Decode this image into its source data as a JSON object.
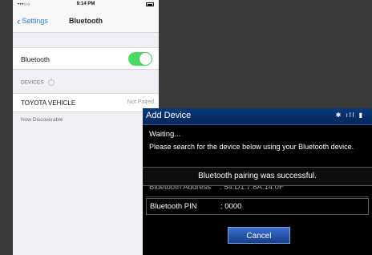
{
  "phone": {
    "status": {
      "signal": "•••○○",
      "time": "9:14 PM"
    },
    "nav": {
      "back_label": "Settings",
      "title": "Bluetooth"
    },
    "bluetooth_row": {
      "label": "Bluetooth",
      "toggle_on": true
    },
    "devices_header": "DEVICES",
    "device": {
      "name": "TOYOTA VEHICLE",
      "state": "Not Paired"
    },
    "footer_note": "Now Discoverable"
  },
  "car": {
    "title": "Add Device",
    "icons": "✱ ıll ▮",
    "waiting": "Waiting...",
    "instruction": "Please search for the device below using your Bluetooth device.",
    "popup": "Bluetooth pairing was successful.",
    "address_label": "Bluetooth Address",
    "address_value": ": 54:D1:7:8A:14:0F",
    "pin_label": "Bluetooth PIN",
    "pin_value": ": 0000",
    "cancel_label": "Cancel"
  },
  "colors": {
    "toggle_on": "#4cd964",
    "ios_blue": "#2a7ad6",
    "car_header": "#0a3a7a"
  }
}
